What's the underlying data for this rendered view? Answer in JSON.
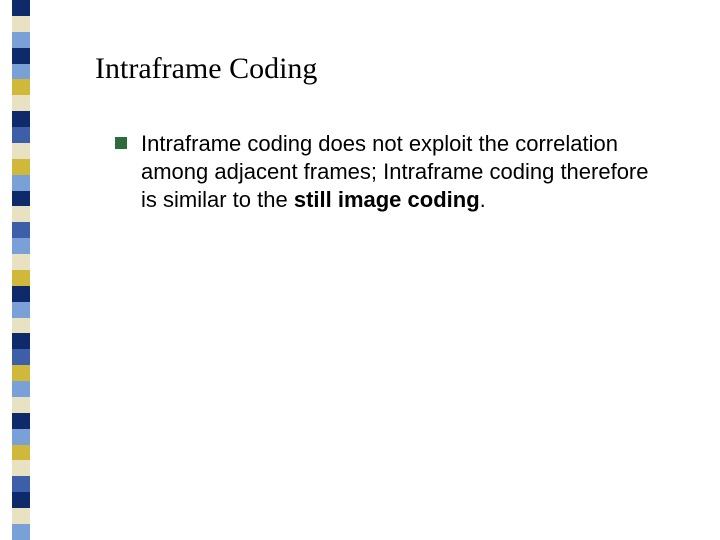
{
  "title": "Intraframe Coding",
  "body": {
    "part1": "Intraframe coding does not exploit the correlation among adjacent frames; Intraframe coding therefore is similar to the ",
    "bold": "still image coding",
    "part2": "."
  },
  "sidebarColors": [
    "#0f2a6b",
    "#e9e2c2",
    "#7aa0d8",
    "#0f2a6b",
    "#7aa0d8",
    "#d0b83a",
    "#e9e2c2",
    "#0f2a6b",
    "#3c5fa8",
    "#e9e2c2",
    "#d0b83a",
    "#7aa0d8",
    "#0f2a6b",
    "#e9e2c2",
    "#3c5fa8",
    "#7aa0d8",
    "#e9e2c2",
    "#d0b83a",
    "#0f2a6b",
    "#7aa0d8",
    "#e9e2c2",
    "#0f2a6b",
    "#3c5fa8",
    "#d0b83a",
    "#7aa0d8",
    "#e9e2c2",
    "#0f2a6b",
    "#7aa0d8",
    "#d0b83a",
    "#e9e2c2",
    "#3c5fa8",
    "#0f2a6b",
    "#e9e2c2",
    "#7aa0d8"
  ]
}
